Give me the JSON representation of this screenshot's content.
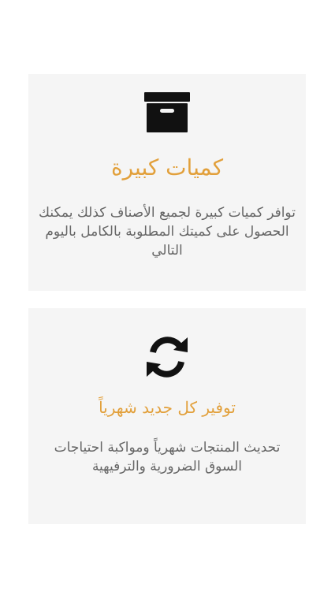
{
  "cards": [
    {
      "icon": "archive-box-icon",
      "title": "كميات كبيرة",
      "description": "توافر كميات كبيرة لجميع الأصناف كذلك يمكنك الحصول على كميتك المطلوبة بالكامل باليوم التالي"
    },
    {
      "icon": "refresh-arrows-icon",
      "title": "توفير كل جديد شهرياً",
      "description": "تحديث المنتجات شهرياً ومواكبة احتياجات السوق الضرورية والترفيهية"
    }
  ],
  "colors": {
    "card_background": "#f5f5f5",
    "title": "#e2a03b",
    "description": "#666666",
    "icon": "#111111"
  }
}
